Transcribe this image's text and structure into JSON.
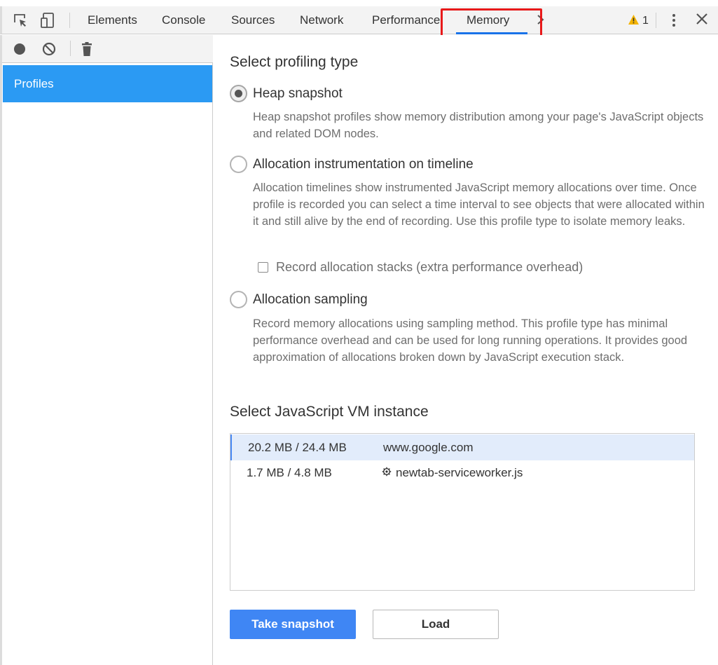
{
  "tabbar": {
    "tabs": [
      {
        "label": "Elements"
      },
      {
        "label": "Console"
      },
      {
        "label": "Sources"
      },
      {
        "label": "Network"
      },
      {
        "label": "Performance"
      },
      {
        "label": "Memory",
        "active": true
      }
    ],
    "warnings_count": "1",
    "icons": [
      "inspect-element-icon",
      "device-toolbar-icon",
      "overflow-chevron-icon",
      "warning-icon",
      "kebab-menu-icon",
      "close-icon"
    ],
    "highlight_color": "#e8191a"
  },
  "sidebar": {
    "toolbar_icons": [
      "record-icon",
      "clear-icon",
      "trash-icon"
    ],
    "profiles_label": "Profiles",
    "profiles_bg": "#2b9af3"
  },
  "main": {
    "profiling_heading": "Select profiling type",
    "options": [
      {
        "label": "Heap snapshot",
        "checked": true,
        "description": "Heap snapshot profiles show memory distribution among your page's JavaScript objects and related DOM nodes."
      },
      {
        "label": "Allocation instrumentation on timeline",
        "checked": false,
        "description": "Allocation timelines show instrumented JavaScript memory allocations over time. Once profile is recorded you can select a time interval to see objects that were allocated within it and still alive by the end of recording. Use this profile type to isolate memory leaks."
      },
      {
        "label": "Allocation sampling",
        "checked": false,
        "description": "Record memory allocations using sampling method. This profile type has minimal performance overhead and can be used for long running operations. It provides good approximation of allocations broken down by JavaScript execution stack."
      }
    ],
    "record_stacks_label": "Record allocation stacks (extra performance overhead)",
    "vm_heading": "Select JavaScript VM instance",
    "vm_instances": [
      {
        "size": "20.2 MB / 24.4 MB",
        "name": "www.google.com",
        "selected": true
      },
      {
        "size": "1.7 MB / 4.8 MB",
        "name": "newtab-serviceworker.js",
        "icon": "gear-icon",
        "selected": false
      }
    ],
    "take_snapshot_label": "Take snapshot",
    "load_label": "Load",
    "primary_color": "#3f86f4"
  }
}
